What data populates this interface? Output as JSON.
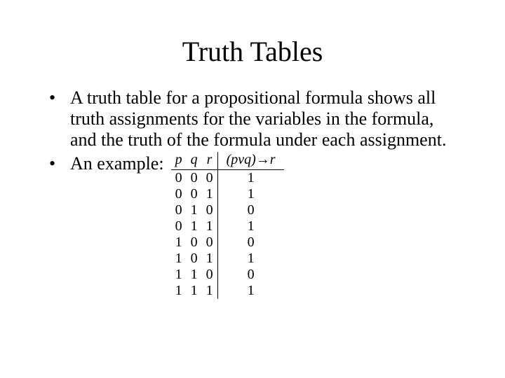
{
  "title": "Truth Tables",
  "bullet1": "A truth table for a propositional formula shows all truth assignments for the variables in the formula, and the truth of the formula under each assignment.",
  "bullet2_label": "An example:",
  "table": {
    "headers": {
      "p": "p",
      "q": "q",
      "r": "r",
      "result": "(pvq)→r"
    },
    "rows": [
      {
        "p": "0",
        "q": "0",
        "r": "0",
        "result": "1"
      },
      {
        "p": "0",
        "q": "0",
        "r": "1",
        "result": "1"
      },
      {
        "p": "0",
        "q": "1",
        "r": "0",
        "result": "0"
      },
      {
        "p": "0",
        "q": "1",
        "r": "1",
        "result": "1"
      },
      {
        "p": "1",
        "q": "0",
        "r": "0",
        "result": "0"
      },
      {
        "p": "1",
        "q": "0",
        "r": "1",
        "result": "1"
      },
      {
        "p": "1",
        "q": "1",
        "r": "0",
        "result": "0"
      },
      {
        "p": "1",
        "q": "1",
        "r": "1",
        "result": "1"
      }
    ]
  }
}
